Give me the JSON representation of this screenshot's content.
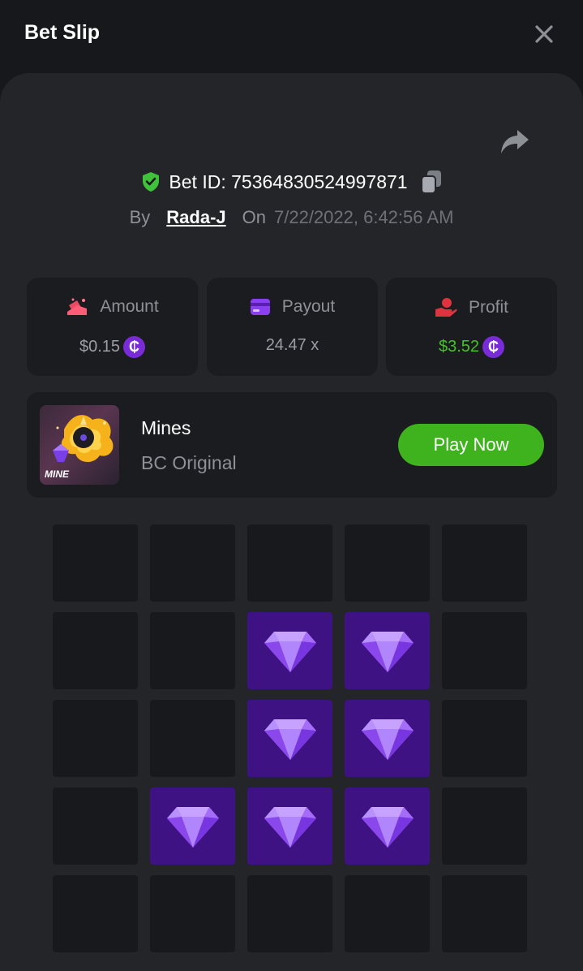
{
  "header": {
    "title": "Bet Slip"
  },
  "bet": {
    "id_text": "Bet ID: 75364830524997871",
    "by_label": "By",
    "user": "Rada-J",
    "on_label": "On",
    "datetime": "7/22/2022, 6:42:56 AM"
  },
  "stats": [
    {
      "label": "Amount",
      "value": "$0.15",
      "icon": "amount-icon",
      "value_color": "#9a9da3",
      "has_coin": true
    },
    {
      "label": "Payout",
      "value": "24.47 x",
      "icon": "payout-card-icon",
      "value_color": "#9a9da3",
      "has_coin": false
    },
    {
      "label": "Profit",
      "value": "$3.52",
      "icon": "profit-hand-icon",
      "value_color": "#45c12a",
      "has_coin": true
    }
  ],
  "coin_symbol": "₵",
  "game": {
    "name": "Mines",
    "provider": "BC Original",
    "play_label": "Play Now",
    "thumb_label": "MINE"
  },
  "board": [
    [
      0,
      0,
      0,
      0,
      0
    ],
    [
      0,
      0,
      1,
      1,
      0
    ],
    [
      0,
      0,
      1,
      1,
      0
    ],
    [
      0,
      1,
      1,
      1,
      0
    ],
    [
      0,
      0,
      0,
      0,
      0
    ]
  ],
  "colors": {
    "accent_green": "#3eb31d",
    "gem_tile": "#3e1282",
    "coin": "#7a2bd8",
    "shield": "#3ec33a"
  }
}
